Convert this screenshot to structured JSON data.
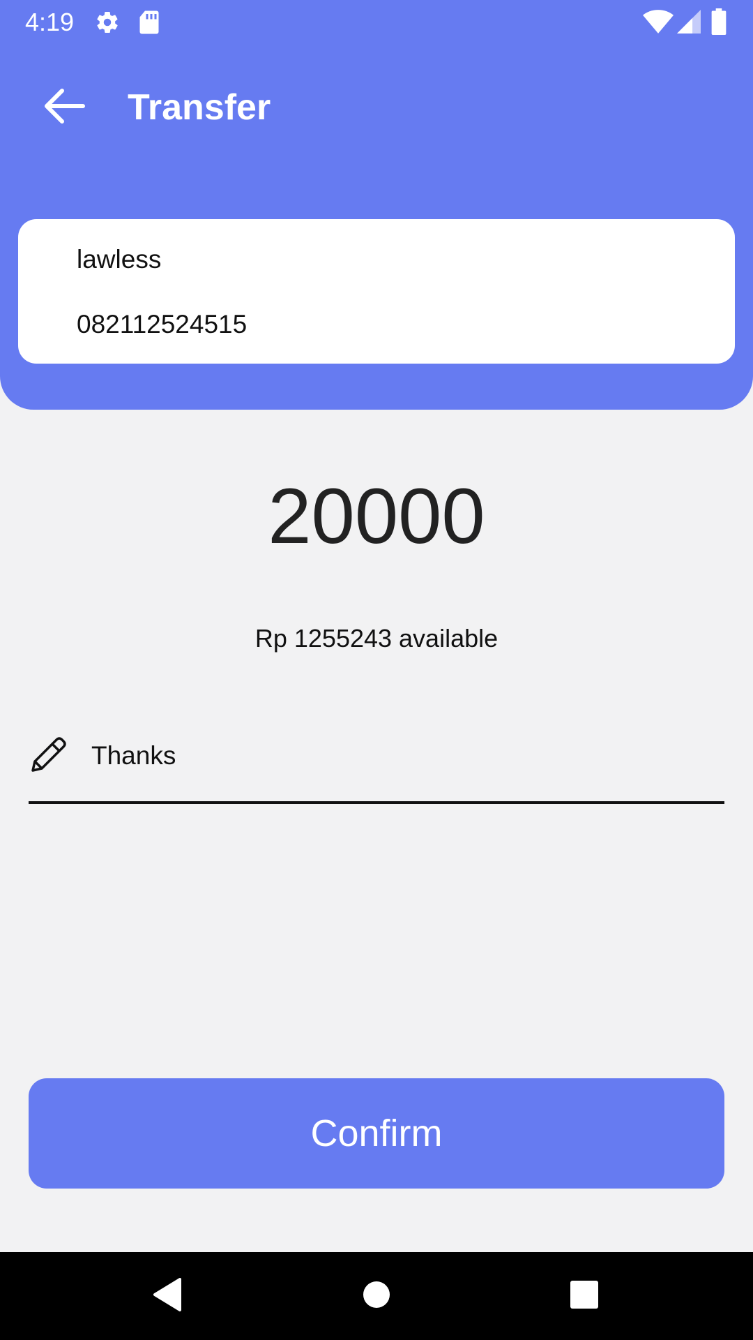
{
  "status_bar": {
    "time": "4:19",
    "icons": [
      "gear-icon",
      "sd-card-icon",
      "wifi-icon",
      "cell-signal-icon",
      "battery-icon"
    ]
  },
  "toolbar": {
    "back_icon": "arrow-left-icon",
    "title": "Transfer"
  },
  "recipient": {
    "name": "lawless",
    "phone": "082112524515"
  },
  "transfer": {
    "amount": "20000",
    "available_text": "Rp 1255243 available"
  },
  "note": {
    "icon": "pencil-icon",
    "value": "Thanks"
  },
  "actions": {
    "confirm_label": "Confirm"
  },
  "nav_bar": {
    "icons": [
      "back-triangle-icon",
      "home-circle-icon",
      "recents-square-icon"
    ]
  },
  "colors": {
    "accent": "#667bf1",
    "background": "#f2f2f3",
    "card": "#ffffff",
    "text": "#111111",
    "nav_bar": "#000000"
  }
}
